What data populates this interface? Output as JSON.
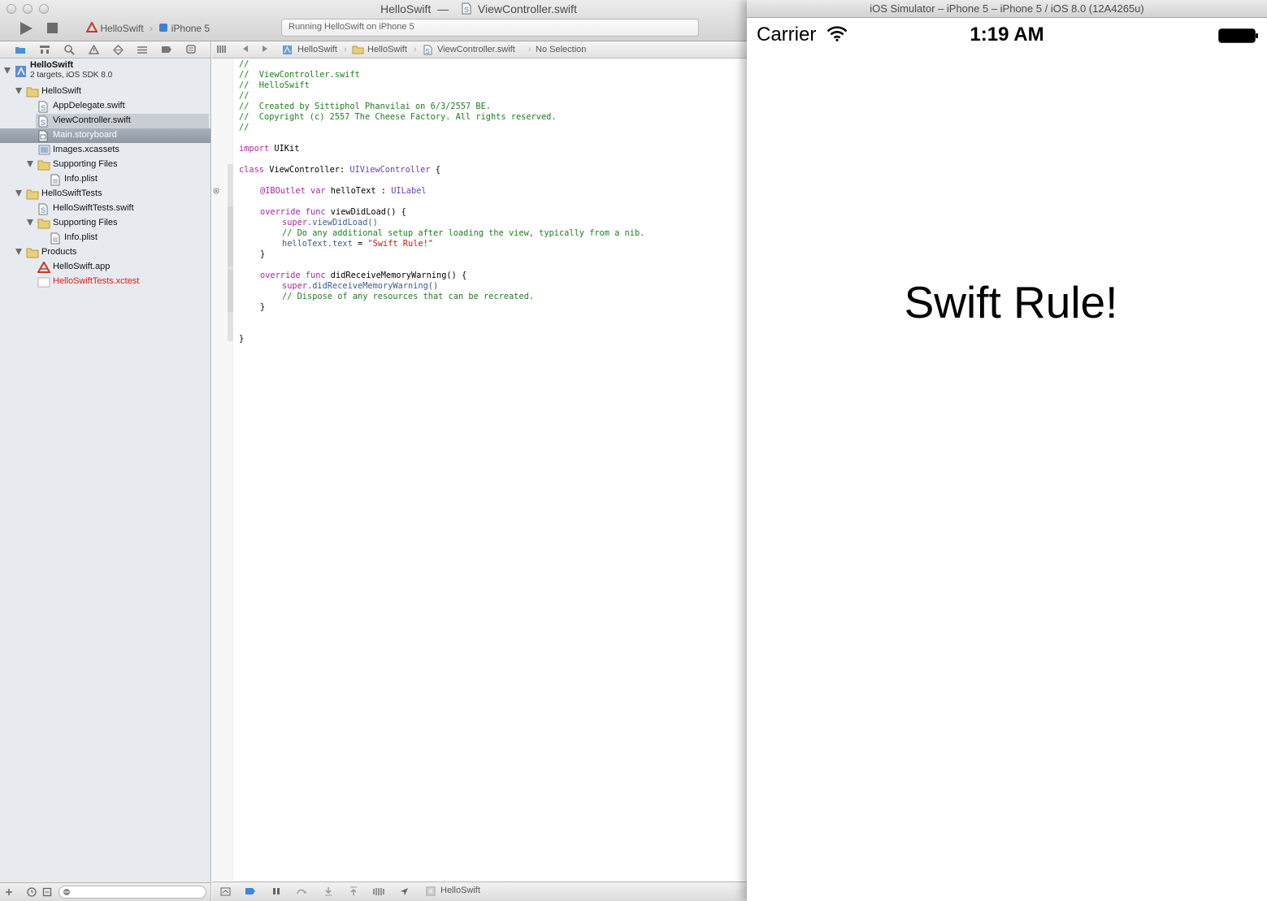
{
  "xcode": {
    "window_title": {
      "project": "HelloSwift",
      "separator": "—",
      "file": "ViewController.swift"
    },
    "scheme": {
      "project": "HelloSwift",
      "device": "iPhone 5"
    },
    "activity_status": "Running HelloSwift on iPhone 5",
    "navigator": {
      "project_name": "HelloSwift",
      "project_subtitle": "2 targets, iOS SDK 8.0",
      "items": [
        {
          "label": "HelloSwift"
        },
        {
          "label": "AppDelegate.swift"
        },
        {
          "label": "ViewController.swift"
        },
        {
          "label": "Main.storyboard"
        },
        {
          "label": "Images.xcassets"
        },
        {
          "label": "Supporting Files"
        },
        {
          "label": "Info.plist"
        },
        {
          "label": "HelloSwiftTests"
        },
        {
          "label": "HelloSwiftTests.swift"
        },
        {
          "label": "Supporting Files"
        },
        {
          "label": "Info.plist"
        },
        {
          "label": "Products"
        },
        {
          "label": "HelloSwift.app"
        },
        {
          "label": "HelloSwiftTests.xctest"
        }
      ]
    },
    "jumpbar": {
      "project": "HelloSwift",
      "group": "HelloSwift",
      "file": "ViewController.swift",
      "selection": "No Selection"
    },
    "code": {
      "l1": "//",
      "l2": "//  ViewController.swift",
      "l3": "//  HelloSwift",
      "l4": "//",
      "l5": "//  Created by Sittiphol Phanvilai on 6/3/2557 BE.",
      "l6": "//  Copyright (c) 2557 The Cheese Factory. All rights reserved.",
      "l7": "//",
      "import_kw": "import",
      "import_mod": " UIKit",
      "class_kw": "class",
      "class_name": " ViewController: ",
      "class_super": "UIViewController",
      "class_brace": " {",
      "outlet_attr": "@IBOutlet",
      "outlet_var": " var",
      "outlet_name": " helloText : ",
      "outlet_type": "UILabel",
      "override1": "override",
      "func1": " func",
      "func1_name": " viewDidLoad() {",
      "super1": "super",
      "super1_call": ".viewDidLoad()",
      "comment1": "// Do any additional setup after loading the view, typically from a nib.",
      "assign_obj": "helloText",
      "assign_prop": ".text",
      "assign_eq": " = ",
      "assign_str": "\"Swift Rule!\"",
      "close1": "}",
      "override2": "override",
      "func2": " func",
      "func2_name": " didReceiveMemoryWarning() {",
      "super2": "super",
      "super2_call": ".didReceiveMemoryWarning()",
      "comment2": "// Dispose of any resources that can be recreated.",
      "close2": "}",
      "close3": "}"
    },
    "debug_target": "HelloSwift"
  },
  "simulator": {
    "title": "iOS Simulator – iPhone 5 – iPhone 5 / iOS 8.0 (12A4265u)",
    "carrier": "Carrier",
    "time": "1:19 AM",
    "label_text": "Swift Rule!"
  },
  "colors": {
    "keyword": "#b0269c",
    "comment": "#1f7e1f",
    "string": "#c41a16",
    "type": "#6f41a7",
    "missing_file": "#e01b1b"
  }
}
